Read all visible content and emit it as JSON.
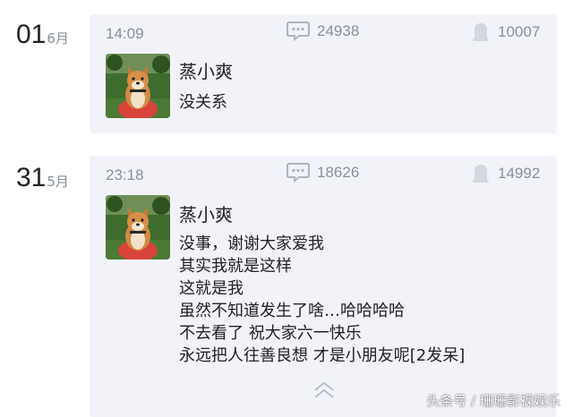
{
  "posts": [
    {
      "day": "01",
      "month": "6月",
      "time": "14:09",
      "comments": "24938",
      "likes": "10007",
      "name": "蒸小爽",
      "lines": [
        "没关系"
      ]
    },
    {
      "day": "31",
      "month": "5月",
      "time": "23:18",
      "comments": "18626",
      "likes": "14992",
      "name": "蒸小爽",
      "lines": [
        "没事，谢谢大家爱我",
        "其实我就是这样",
        "这就是我",
        "虽然不知道发生了啥…哈哈哈哈",
        "不去看了 祝大家六一快乐",
        "永远把人往善良想 才是小朋友呢[2发呆]"
      ]
    }
  ],
  "icons": {
    "comment": "comment-icon",
    "like": "like-icon",
    "expand": "chevron-up-icon"
  },
  "watermark": "头条号 / 珊珊影视娱乐",
  "colors": {
    "card_bg": "#f1f3f9",
    "meta_text": "#8a8f99",
    "icon": "#aeb3bd"
  }
}
